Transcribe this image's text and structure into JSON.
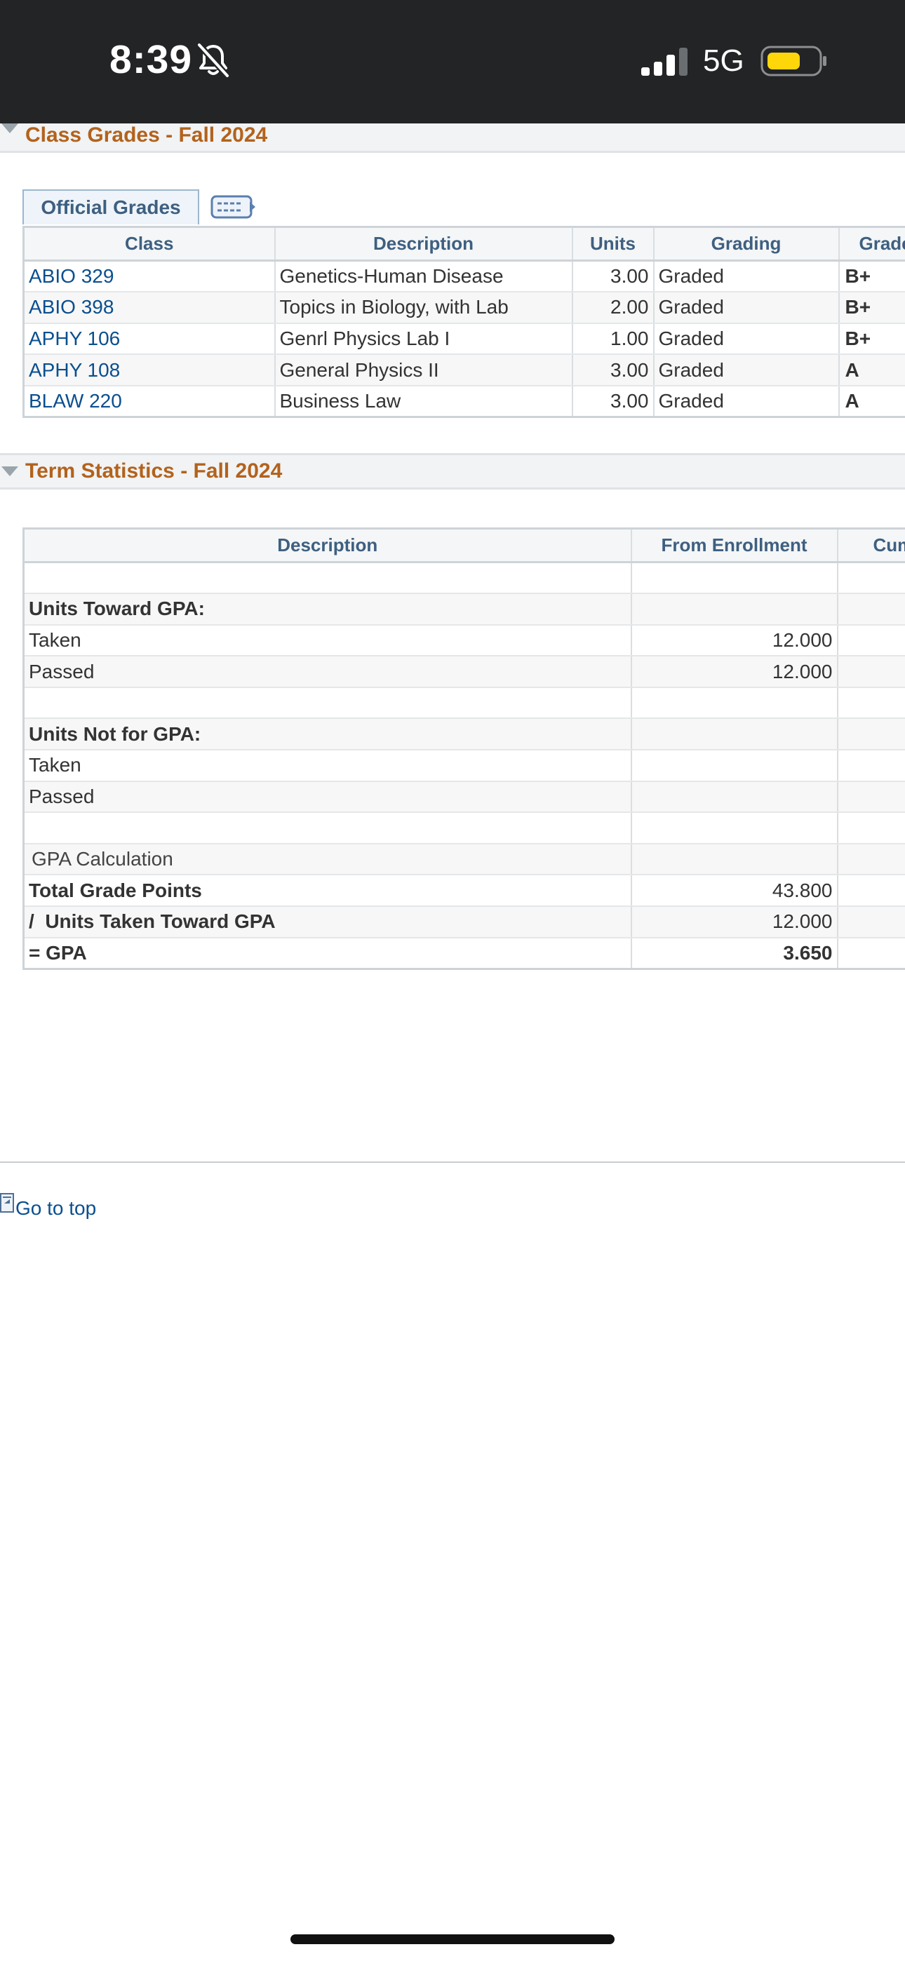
{
  "status_bar": {
    "time": "8:39",
    "network": "5G",
    "icons": [
      "bell-slash-icon",
      "cellular-signal-icon",
      "battery-icon"
    ],
    "battery_color": "#ffd60a"
  },
  "class_grades": {
    "title": "Class Grades - Fall 2024",
    "tab_label": "Official Grades",
    "columns": [
      "Class",
      "Description",
      "Units",
      "Grading",
      "Grade"
    ],
    "rows": [
      {
        "class": "ABIO 329",
        "description": "Genetics-Human Disease",
        "units": "3.00",
        "grading": "Graded",
        "grade": "B+"
      },
      {
        "class": "ABIO 398",
        "description": "Topics in Biology, with Lab",
        "units": "2.00",
        "grading": "Graded",
        "grade": "B+"
      },
      {
        "class": "APHY 106",
        "description": "Genrl Physics Lab I",
        "units": "1.00",
        "grading": "Graded",
        "grade": "B+"
      },
      {
        "class": "APHY 108",
        "description": "General Physics II",
        "units": "3.00",
        "grading": "Graded",
        "grade": "A"
      },
      {
        "class": "BLAW 220",
        "description": "Business Law",
        "units": "3.00",
        "grading": "Graded",
        "grade": "A"
      }
    ]
  },
  "term_statistics": {
    "title": "Term Statistics - Fall 2024",
    "columns": [
      "Description",
      "From Enrollment",
      "Cum"
    ],
    "rows": [
      {
        "description": "",
        "value": ""
      },
      {
        "description": "Units Toward GPA:",
        "value": ""
      },
      {
        "description": "Taken",
        "value": "12.000"
      },
      {
        "description": "Passed",
        "value": "12.000"
      },
      {
        "description": "",
        "value": ""
      },
      {
        "description": "Units Not for GPA:",
        "value": ""
      },
      {
        "description": "Taken",
        "value": ""
      },
      {
        "description": "Passed",
        "value": ""
      },
      {
        "description": "",
        "value": ""
      },
      {
        "description": "GPA Calculation",
        "value": ""
      },
      {
        "description": "Total Grade Points",
        "value": "43.800"
      },
      {
        "description": "/  Units Taken Toward GPA",
        "value": "12.000"
      },
      {
        "description": "= GPA",
        "value": "3.650"
      }
    ]
  },
  "footer": {
    "go_to_top": "Go to top"
  }
}
